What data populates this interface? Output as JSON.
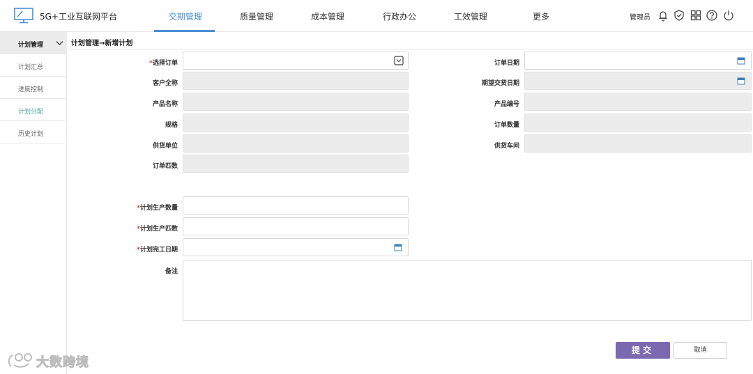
{
  "app": {
    "title": "5G+工业互联网平台"
  },
  "nav": {
    "items": [
      {
        "label": "交期管理",
        "active": true
      },
      {
        "label": "质量管理"
      },
      {
        "label": "成本管理"
      },
      {
        "label": "行政办公"
      },
      {
        "label": "工效管理"
      },
      {
        "label": "更多"
      }
    ]
  },
  "header_right": {
    "user_label": "管理员",
    "icons": [
      "bell-icon",
      "shield-check-icon",
      "grid-icon",
      "help-icon",
      "power-icon"
    ]
  },
  "sidebar": {
    "header": "计划管理",
    "items": [
      {
        "label": "计划汇总"
      },
      {
        "label": "进度控制"
      },
      {
        "label": "计划分配",
        "active": true
      },
      {
        "label": "历史计划"
      }
    ]
  },
  "breadcrumb": "计划管理→新增计划",
  "form": {
    "left": [
      {
        "label": "选择订单",
        "required": true,
        "value": ""
      },
      {
        "label": "客户全称",
        "value": ""
      },
      {
        "label": "产品名称",
        "value": ""
      },
      {
        "label": "规格",
        "value": ""
      },
      {
        "label": "供货单位",
        "value": ""
      },
      {
        "label": "订单匹数",
        "value": ""
      }
    ],
    "right": [
      {
        "label": "订单日期",
        "value": ""
      },
      {
        "label": "期望交货日期",
        "value": ""
      },
      {
        "label": "产品编号",
        "value": ""
      },
      {
        "label": "订单数量",
        "value": ""
      },
      {
        "label": "供货车间",
        "value": ""
      }
    ],
    "plan": [
      {
        "label": "计划生产数量",
        "required": true,
        "value": ""
      },
      {
        "label": "计划生产匹数",
        "required": true,
        "value": ""
      },
      {
        "label": "计划完工日期",
        "required": true,
        "value": ""
      }
    ],
    "remark": {
      "label": "备注",
      "value": ""
    },
    "required_mark": "*"
  },
  "actions": {
    "submit": "提交",
    "cancel": "取消"
  },
  "watermark": {
    "text": "大数跨境"
  },
  "colors": {
    "accent": "#4a8fd6",
    "submit": "#7b68b0",
    "active_side": "#4aa3a0",
    "required": "#d9372b"
  }
}
